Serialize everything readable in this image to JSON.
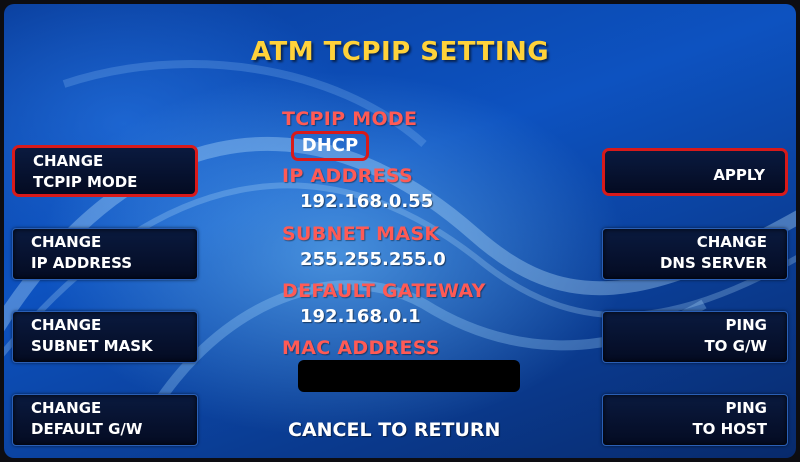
{
  "screen": {
    "title": "ATM TCPIP SETTING"
  },
  "left_buttons": [
    {
      "line1": "CHANGE",
      "line2": "TCPIP MODE"
    },
    {
      "line1": "CHANGE",
      "line2": "IP ADDRESS"
    },
    {
      "line1": "CHANGE",
      "line2": "SUBNET MASK"
    },
    {
      "line1": "CHANGE",
      "line2": "DEFAULT G/W"
    }
  ],
  "right_buttons": [
    {
      "line1": "APPLY"
    },
    {
      "line1": "CHANGE",
      "line2": "DNS SERVER"
    },
    {
      "line1": "PING",
      "line2": "TO G/W"
    },
    {
      "line1": "PING",
      "line2": "TO HOST"
    }
  ],
  "settings": {
    "tcpip_mode": {
      "label": "TCPIP MODE",
      "value": "DHCP"
    },
    "ip_address": {
      "label": "IP ADDRESS",
      "value": "192.168.0.55"
    },
    "subnet_mask": {
      "label": "SUBNET MASK",
      "value": "255.255.255.0"
    },
    "default_gateway": {
      "label": "DEFAULT GATEWAY",
      "value": "192.168.0.1"
    },
    "mac_address": {
      "label": "MAC ADDRESS"
    }
  },
  "footer": {
    "cancel_text": "CANCEL TO RETURN"
  },
  "colors": {
    "title": "#ffd23a",
    "label": "#ff5a55",
    "highlight": "#d81a1a",
    "background": "#0d52c0",
    "button": "#040b22"
  }
}
